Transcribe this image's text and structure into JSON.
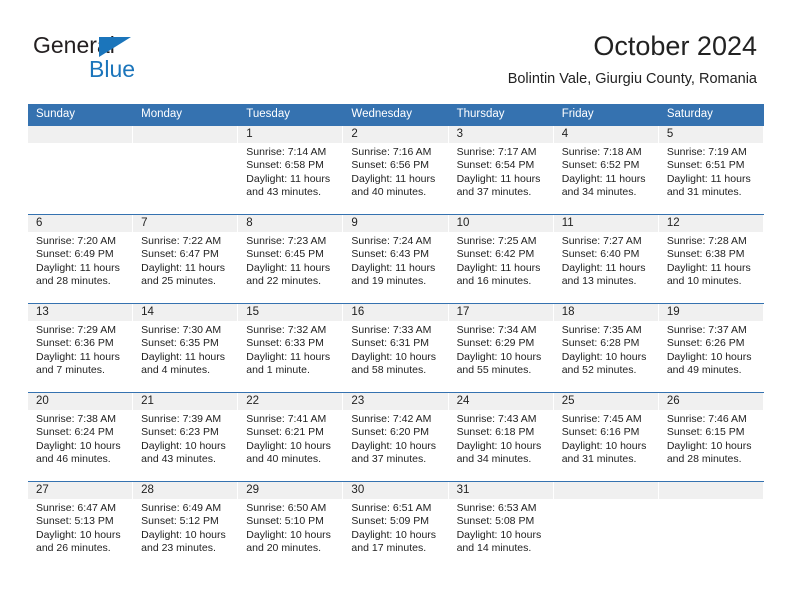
{
  "brand": {
    "name_part1": "General",
    "name_part2": "Blue",
    "accent_color": "#1b75bb"
  },
  "header": {
    "title": "October 2024",
    "subtitle": "Bolintin Vale, Giurgiu County, Romania"
  },
  "theme": {
    "header_blue": "#3572b0",
    "day_strip_gray": "#f0f0f0",
    "text": "#222222"
  },
  "weekdays": [
    "Sunday",
    "Monday",
    "Tuesday",
    "Wednesday",
    "Thursday",
    "Friday",
    "Saturday"
  ],
  "weeks": [
    [
      {
        "day": "",
        "sunrise": "",
        "sunset": "",
        "daylight_line1": "",
        "daylight_line2": ""
      },
      {
        "day": "",
        "sunrise": "",
        "sunset": "",
        "daylight_line1": "",
        "daylight_line2": ""
      },
      {
        "day": "1",
        "sunrise": "Sunrise: 7:14 AM",
        "sunset": "Sunset: 6:58 PM",
        "daylight_line1": "Daylight: 11 hours",
        "daylight_line2": "and 43 minutes."
      },
      {
        "day": "2",
        "sunrise": "Sunrise: 7:16 AM",
        "sunset": "Sunset: 6:56 PM",
        "daylight_line1": "Daylight: 11 hours",
        "daylight_line2": "and 40 minutes."
      },
      {
        "day": "3",
        "sunrise": "Sunrise: 7:17 AM",
        "sunset": "Sunset: 6:54 PM",
        "daylight_line1": "Daylight: 11 hours",
        "daylight_line2": "and 37 minutes."
      },
      {
        "day": "4",
        "sunrise": "Sunrise: 7:18 AM",
        "sunset": "Sunset: 6:52 PM",
        "daylight_line1": "Daylight: 11 hours",
        "daylight_line2": "and 34 minutes."
      },
      {
        "day": "5",
        "sunrise": "Sunrise: 7:19 AM",
        "sunset": "Sunset: 6:51 PM",
        "daylight_line1": "Daylight: 11 hours",
        "daylight_line2": "and 31 minutes."
      }
    ],
    [
      {
        "day": "6",
        "sunrise": "Sunrise: 7:20 AM",
        "sunset": "Sunset: 6:49 PM",
        "daylight_line1": "Daylight: 11 hours",
        "daylight_line2": "and 28 minutes."
      },
      {
        "day": "7",
        "sunrise": "Sunrise: 7:22 AM",
        "sunset": "Sunset: 6:47 PM",
        "daylight_line1": "Daylight: 11 hours",
        "daylight_line2": "and 25 minutes."
      },
      {
        "day": "8",
        "sunrise": "Sunrise: 7:23 AM",
        "sunset": "Sunset: 6:45 PM",
        "daylight_line1": "Daylight: 11 hours",
        "daylight_line2": "and 22 minutes."
      },
      {
        "day": "9",
        "sunrise": "Sunrise: 7:24 AM",
        "sunset": "Sunset: 6:43 PM",
        "daylight_line1": "Daylight: 11 hours",
        "daylight_line2": "and 19 minutes."
      },
      {
        "day": "10",
        "sunrise": "Sunrise: 7:25 AM",
        "sunset": "Sunset: 6:42 PM",
        "daylight_line1": "Daylight: 11 hours",
        "daylight_line2": "and 16 minutes."
      },
      {
        "day": "11",
        "sunrise": "Sunrise: 7:27 AM",
        "sunset": "Sunset: 6:40 PM",
        "daylight_line1": "Daylight: 11 hours",
        "daylight_line2": "and 13 minutes."
      },
      {
        "day": "12",
        "sunrise": "Sunrise: 7:28 AM",
        "sunset": "Sunset: 6:38 PM",
        "daylight_line1": "Daylight: 11 hours",
        "daylight_line2": "and 10 minutes."
      }
    ],
    [
      {
        "day": "13",
        "sunrise": "Sunrise: 7:29 AM",
        "sunset": "Sunset: 6:36 PM",
        "daylight_line1": "Daylight: 11 hours",
        "daylight_line2": "and 7 minutes."
      },
      {
        "day": "14",
        "sunrise": "Sunrise: 7:30 AM",
        "sunset": "Sunset: 6:35 PM",
        "daylight_line1": "Daylight: 11 hours",
        "daylight_line2": "and 4 minutes."
      },
      {
        "day": "15",
        "sunrise": "Sunrise: 7:32 AM",
        "sunset": "Sunset: 6:33 PM",
        "daylight_line1": "Daylight: 11 hours",
        "daylight_line2": "and 1 minute."
      },
      {
        "day": "16",
        "sunrise": "Sunrise: 7:33 AM",
        "sunset": "Sunset: 6:31 PM",
        "daylight_line1": "Daylight: 10 hours",
        "daylight_line2": "and 58 minutes."
      },
      {
        "day": "17",
        "sunrise": "Sunrise: 7:34 AM",
        "sunset": "Sunset: 6:29 PM",
        "daylight_line1": "Daylight: 10 hours",
        "daylight_line2": "and 55 minutes."
      },
      {
        "day": "18",
        "sunrise": "Sunrise: 7:35 AM",
        "sunset": "Sunset: 6:28 PM",
        "daylight_line1": "Daylight: 10 hours",
        "daylight_line2": "and 52 minutes."
      },
      {
        "day": "19",
        "sunrise": "Sunrise: 7:37 AM",
        "sunset": "Sunset: 6:26 PM",
        "daylight_line1": "Daylight: 10 hours",
        "daylight_line2": "and 49 minutes."
      }
    ],
    [
      {
        "day": "20",
        "sunrise": "Sunrise: 7:38 AM",
        "sunset": "Sunset: 6:24 PM",
        "daylight_line1": "Daylight: 10 hours",
        "daylight_line2": "and 46 minutes."
      },
      {
        "day": "21",
        "sunrise": "Sunrise: 7:39 AM",
        "sunset": "Sunset: 6:23 PM",
        "daylight_line1": "Daylight: 10 hours",
        "daylight_line2": "and 43 minutes."
      },
      {
        "day": "22",
        "sunrise": "Sunrise: 7:41 AM",
        "sunset": "Sunset: 6:21 PM",
        "daylight_line1": "Daylight: 10 hours",
        "daylight_line2": "and 40 minutes."
      },
      {
        "day": "23",
        "sunrise": "Sunrise: 7:42 AM",
        "sunset": "Sunset: 6:20 PM",
        "daylight_line1": "Daylight: 10 hours",
        "daylight_line2": "and 37 minutes."
      },
      {
        "day": "24",
        "sunrise": "Sunrise: 7:43 AM",
        "sunset": "Sunset: 6:18 PM",
        "daylight_line1": "Daylight: 10 hours",
        "daylight_line2": "and 34 minutes."
      },
      {
        "day": "25",
        "sunrise": "Sunrise: 7:45 AM",
        "sunset": "Sunset: 6:16 PM",
        "daylight_line1": "Daylight: 10 hours",
        "daylight_line2": "and 31 minutes."
      },
      {
        "day": "26",
        "sunrise": "Sunrise: 7:46 AM",
        "sunset": "Sunset: 6:15 PM",
        "daylight_line1": "Daylight: 10 hours",
        "daylight_line2": "and 28 minutes."
      }
    ],
    [
      {
        "day": "27",
        "sunrise": "Sunrise: 6:47 AM",
        "sunset": "Sunset: 5:13 PM",
        "daylight_line1": "Daylight: 10 hours",
        "daylight_line2": "and 26 minutes."
      },
      {
        "day": "28",
        "sunrise": "Sunrise: 6:49 AM",
        "sunset": "Sunset: 5:12 PM",
        "daylight_line1": "Daylight: 10 hours",
        "daylight_line2": "and 23 minutes."
      },
      {
        "day": "29",
        "sunrise": "Sunrise: 6:50 AM",
        "sunset": "Sunset: 5:10 PM",
        "daylight_line1": "Daylight: 10 hours",
        "daylight_line2": "and 20 minutes."
      },
      {
        "day": "30",
        "sunrise": "Sunrise: 6:51 AM",
        "sunset": "Sunset: 5:09 PM",
        "daylight_line1": "Daylight: 10 hours",
        "daylight_line2": "and 17 minutes."
      },
      {
        "day": "31",
        "sunrise": "Sunrise: 6:53 AM",
        "sunset": "Sunset: 5:08 PM",
        "daylight_line1": "Daylight: 10 hours",
        "daylight_line2": "and 14 minutes."
      },
      {
        "day": "",
        "sunrise": "",
        "sunset": "",
        "daylight_line1": "",
        "daylight_line2": ""
      },
      {
        "day": "",
        "sunrise": "",
        "sunset": "",
        "daylight_line1": "",
        "daylight_line2": ""
      }
    ]
  ]
}
